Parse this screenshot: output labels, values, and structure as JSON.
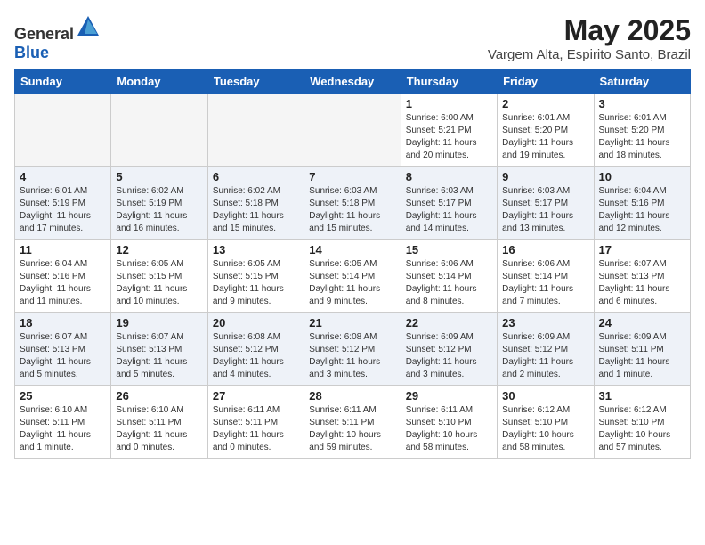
{
  "app": {
    "logo_general": "General",
    "logo_blue": "Blue"
  },
  "header": {
    "month": "May 2025",
    "location": "Vargem Alta, Espirito Santo, Brazil"
  },
  "weekdays": [
    "Sunday",
    "Monday",
    "Tuesday",
    "Wednesday",
    "Thursday",
    "Friday",
    "Saturday"
  ],
  "weeks": [
    [
      {
        "day": "",
        "info": ""
      },
      {
        "day": "",
        "info": ""
      },
      {
        "day": "",
        "info": ""
      },
      {
        "day": "",
        "info": ""
      },
      {
        "day": "1",
        "info": "Sunrise: 6:00 AM\nSunset: 5:21 PM\nDaylight: 11 hours\nand 20 minutes."
      },
      {
        "day": "2",
        "info": "Sunrise: 6:01 AM\nSunset: 5:20 PM\nDaylight: 11 hours\nand 19 minutes."
      },
      {
        "day": "3",
        "info": "Sunrise: 6:01 AM\nSunset: 5:20 PM\nDaylight: 11 hours\nand 18 minutes."
      }
    ],
    [
      {
        "day": "4",
        "info": "Sunrise: 6:01 AM\nSunset: 5:19 PM\nDaylight: 11 hours\nand 17 minutes."
      },
      {
        "day": "5",
        "info": "Sunrise: 6:02 AM\nSunset: 5:19 PM\nDaylight: 11 hours\nand 16 minutes."
      },
      {
        "day": "6",
        "info": "Sunrise: 6:02 AM\nSunset: 5:18 PM\nDaylight: 11 hours\nand 15 minutes."
      },
      {
        "day": "7",
        "info": "Sunrise: 6:03 AM\nSunset: 5:18 PM\nDaylight: 11 hours\nand 15 minutes."
      },
      {
        "day": "8",
        "info": "Sunrise: 6:03 AM\nSunset: 5:17 PM\nDaylight: 11 hours\nand 14 minutes."
      },
      {
        "day": "9",
        "info": "Sunrise: 6:03 AM\nSunset: 5:17 PM\nDaylight: 11 hours\nand 13 minutes."
      },
      {
        "day": "10",
        "info": "Sunrise: 6:04 AM\nSunset: 5:16 PM\nDaylight: 11 hours\nand 12 minutes."
      }
    ],
    [
      {
        "day": "11",
        "info": "Sunrise: 6:04 AM\nSunset: 5:16 PM\nDaylight: 11 hours\nand 11 minutes."
      },
      {
        "day": "12",
        "info": "Sunrise: 6:05 AM\nSunset: 5:15 PM\nDaylight: 11 hours\nand 10 minutes."
      },
      {
        "day": "13",
        "info": "Sunrise: 6:05 AM\nSunset: 5:15 PM\nDaylight: 11 hours\nand 9 minutes."
      },
      {
        "day": "14",
        "info": "Sunrise: 6:05 AM\nSunset: 5:14 PM\nDaylight: 11 hours\nand 9 minutes."
      },
      {
        "day": "15",
        "info": "Sunrise: 6:06 AM\nSunset: 5:14 PM\nDaylight: 11 hours\nand 8 minutes."
      },
      {
        "day": "16",
        "info": "Sunrise: 6:06 AM\nSunset: 5:14 PM\nDaylight: 11 hours\nand 7 minutes."
      },
      {
        "day": "17",
        "info": "Sunrise: 6:07 AM\nSunset: 5:13 PM\nDaylight: 11 hours\nand 6 minutes."
      }
    ],
    [
      {
        "day": "18",
        "info": "Sunrise: 6:07 AM\nSunset: 5:13 PM\nDaylight: 11 hours\nand 5 minutes."
      },
      {
        "day": "19",
        "info": "Sunrise: 6:07 AM\nSunset: 5:13 PM\nDaylight: 11 hours\nand 5 minutes."
      },
      {
        "day": "20",
        "info": "Sunrise: 6:08 AM\nSunset: 5:12 PM\nDaylight: 11 hours\nand 4 minutes."
      },
      {
        "day": "21",
        "info": "Sunrise: 6:08 AM\nSunset: 5:12 PM\nDaylight: 11 hours\nand 3 minutes."
      },
      {
        "day": "22",
        "info": "Sunrise: 6:09 AM\nSunset: 5:12 PM\nDaylight: 11 hours\nand 3 minutes."
      },
      {
        "day": "23",
        "info": "Sunrise: 6:09 AM\nSunset: 5:12 PM\nDaylight: 11 hours\nand 2 minutes."
      },
      {
        "day": "24",
        "info": "Sunrise: 6:09 AM\nSunset: 5:11 PM\nDaylight: 11 hours\nand 1 minute."
      }
    ],
    [
      {
        "day": "25",
        "info": "Sunrise: 6:10 AM\nSunset: 5:11 PM\nDaylight: 11 hours\nand 1 minute."
      },
      {
        "day": "26",
        "info": "Sunrise: 6:10 AM\nSunset: 5:11 PM\nDaylight: 11 hours\nand 0 minutes."
      },
      {
        "day": "27",
        "info": "Sunrise: 6:11 AM\nSunset: 5:11 PM\nDaylight: 11 hours\nand 0 minutes."
      },
      {
        "day": "28",
        "info": "Sunrise: 6:11 AM\nSunset: 5:11 PM\nDaylight: 10 hours\nand 59 minutes."
      },
      {
        "day": "29",
        "info": "Sunrise: 6:11 AM\nSunset: 5:10 PM\nDaylight: 10 hours\nand 58 minutes."
      },
      {
        "day": "30",
        "info": "Sunrise: 6:12 AM\nSunset: 5:10 PM\nDaylight: 10 hours\nand 58 minutes."
      },
      {
        "day": "31",
        "info": "Sunrise: 6:12 AM\nSunset: 5:10 PM\nDaylight: 10 hours\nand 57 minutes."
      }
    ]
  ]
}
